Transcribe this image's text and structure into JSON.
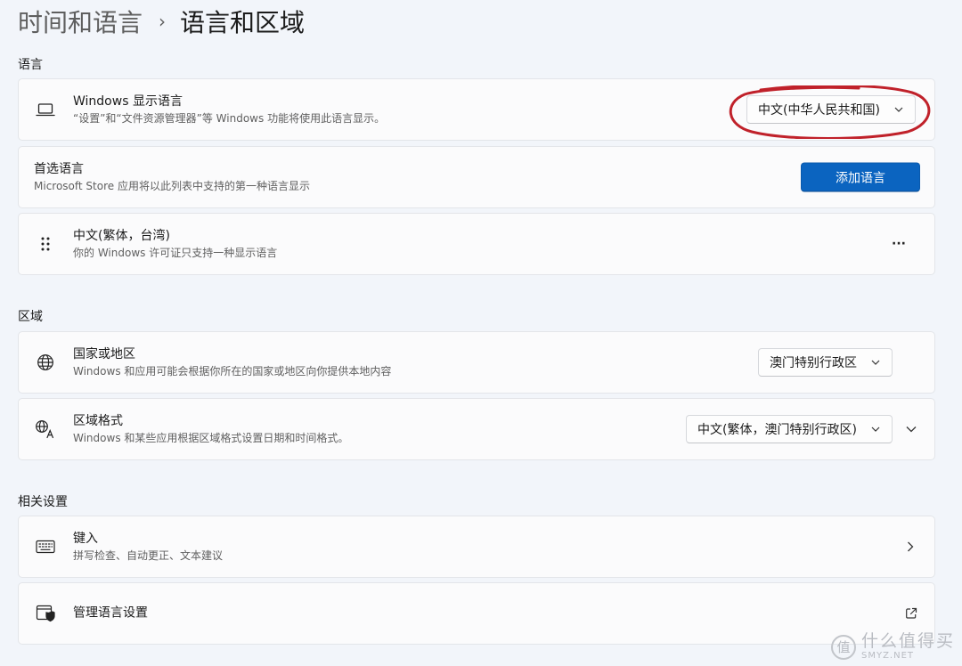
{
  "breadcrumb": {
    "parent": "时间和语言",
    "separator": "›",
    "current": "语言和区域"
  },
  "sections": {
    "language": "语言",
    "region": "区域",
    "related": "相关设置"
  },
  "display_language": {
    "title": "Windows 显示语言",
    "subtitle": "“设置”和“文件资源管理器”等 Windows 功能将使用此语言显示。",
    "value": "中文(中华人民共和国)",
    "icon": "laptop-icon"
  },
  "preferred_languages": {
    "title": "首选语言",
    "subtitle": "Microsoft Store 应用将以此列表中支持的第一种语言显示",
    "add_button": "添加语言"
  },
  "language_item": {
    "title": "中文(繁体，台湾)",
    "subtitle": "你的 Windows 许可证只支持一种显示语言",
    "more": "···"
  },
  "country": {
    "title": "国家或地区",
    "subtitle": "Windows 和应用可能会根据你所在的国家或地区向你提供本地内容",
    "value": "澳门特别行政区",
    "icon": "globe-icon"
  },
  "regional_format": {
    "title": "区域格式",
    "subtitle": "Windows 和某些应用根据区域格式设置日期和时间格式。",
    "value": "中文(繁体，澳门特别行政区)",
    "icon": "language-format-icon"
  },
  "typing": {
    "title": "键入",
    "subtitle": "拼写检查、自动更正、文本建议",
    "icon": "keyboard-icon"
  },
  "admin_language": {
    "title": "管理语言设置",
    "icon": "admin-shield-icon"
  },
  "watermark": {
    "cn": "什么值得买",
    "en": "SMYZ.NET",
    "glyph": "值"
  },
  "colors": {
    "accent": "#0b64c0",
    "annotation": "#c0212a",
    "background": "#f2f5fa"
  }
}
